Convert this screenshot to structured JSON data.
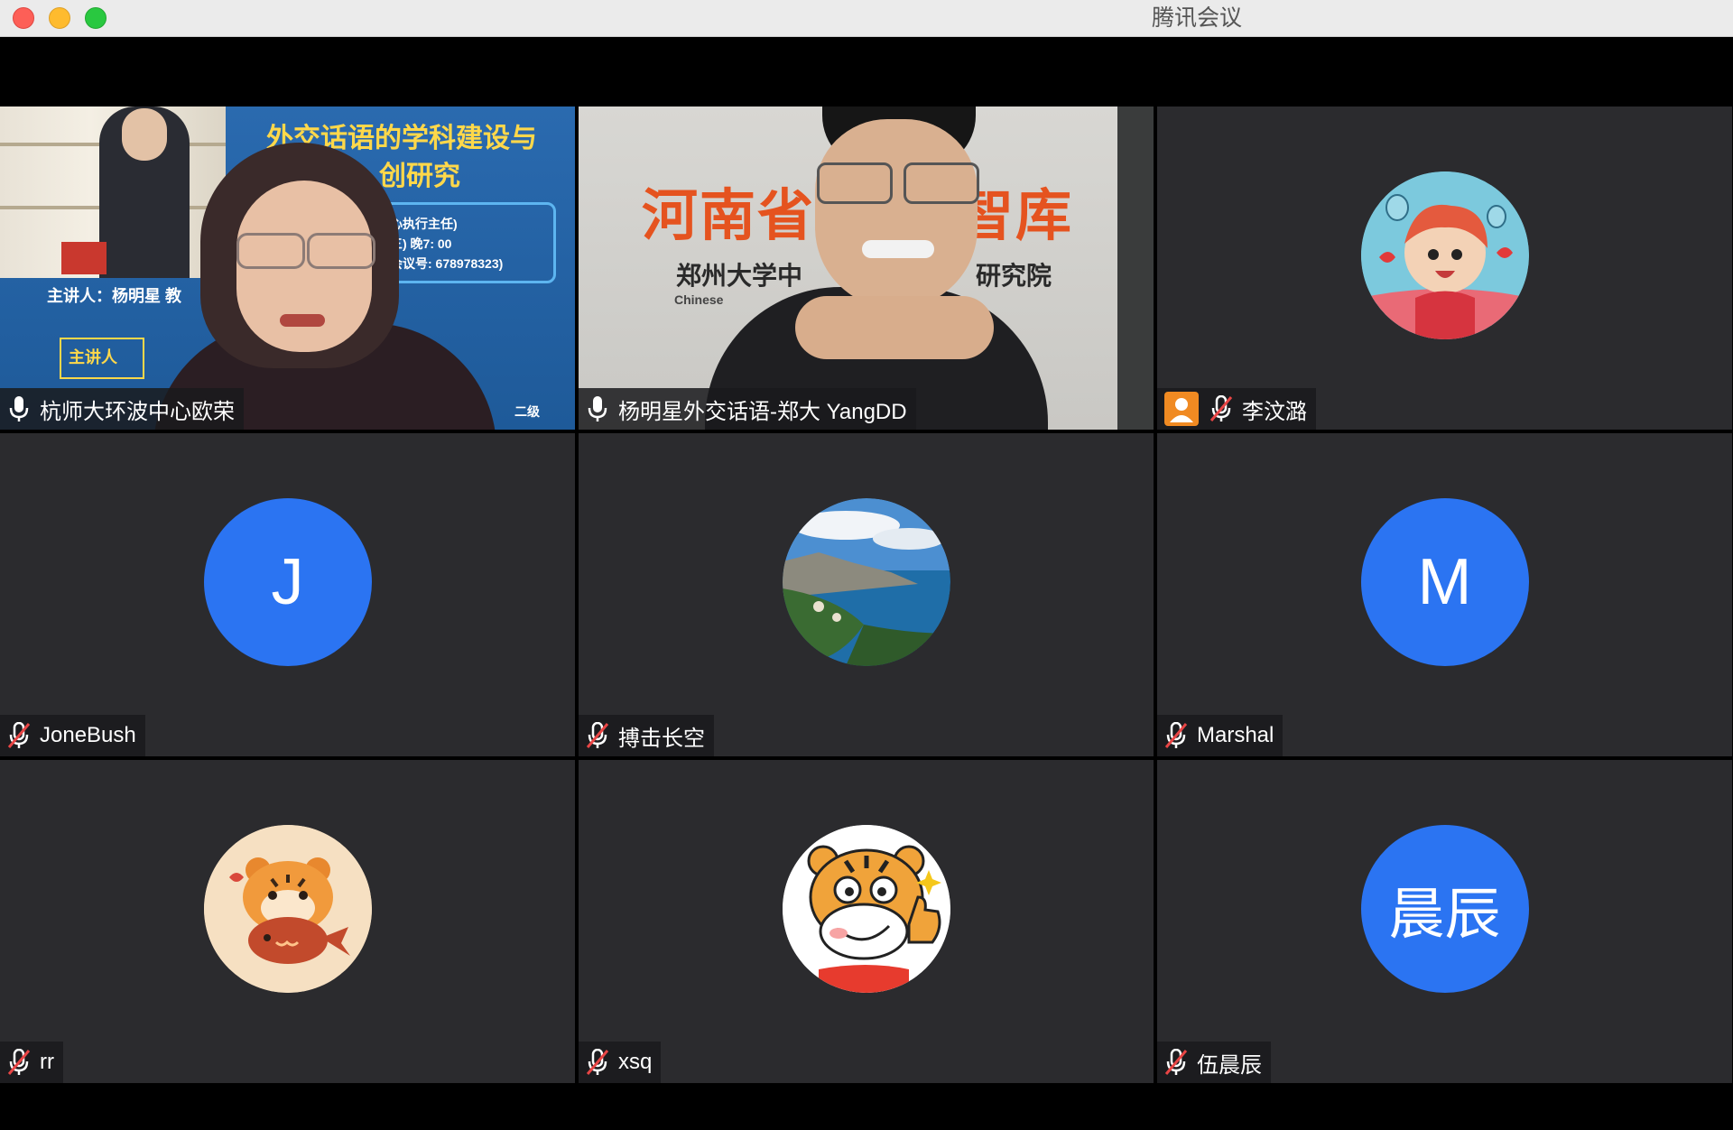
{
  "window": {
    "title": "腾讯会议"
  },
  "participants": [
    {
      "name": "杭师大环波中心欧荣",
      "mic": "on",
      "video": true
    },
    {
      "name": "杨明星外交话语-郑大 YangDD",
      "mic": "on",
      "video": true,
      "active": true
    },
    {
      "name": "李汶潞",
      "mic": "muted",
      "video": false,
      "avatar": "ponyo-sticker"
    },
    {
      "name": "JoneBush",
      "mic": "muted",
      "video": false,
      "avatar_letter": "J"
    },
    {
      "name": "搏击长空",
      "mic": "muted",
      "video": false,
      "avatar": "coastal-landscape-photo"
    },
    {
      "name": "Marshal",
      "mic": "muted",
      "video": false,
      "avatar_letter": "M"
    },
    {
      "name": "rr",
      "mic": "muted",
      "video": false,
      "avatar": "tiger-with-fish-sticker"
    },
    {
      "name": "xsq",
      "mic": "muted",
      "video": false,
      "avatar": "tiger-thumbs-up-sticker"
    },
    {
      "name": "伍晨辰",
      "mic": "muted",
      "video": false,
      "avatar_letter": "晨辰"
    }
  ],
  "video_content": {
    "tile1_banner_line1": "外交话语的学科建设与",
    "tile1_banner_line2": "创研究",
    "tile1_info1": "心执行主任)",
    "tile1_info2": "三) 晚7: 00",
    "tile1_info3": "会议号: 678978323)",
    "tile1_speaker": "主讲人：杨明星 教",
    "tile1_speaker2": "主讲人",
    "tile1_bottom": "二级",
    "tile2_big": "河南省",
    "tile2_big2": "智库",
    "tile2_mid": "郑州大学中",
    "tile2_mid2": "研究院",
    "tile2_small": "Chinese"
  },
  "colors": {
    "avatar_blue": "#2b74f2",
    "active_border": "#3cc36a",
    "tile_bg": "#2b2b2e"
  }
}
